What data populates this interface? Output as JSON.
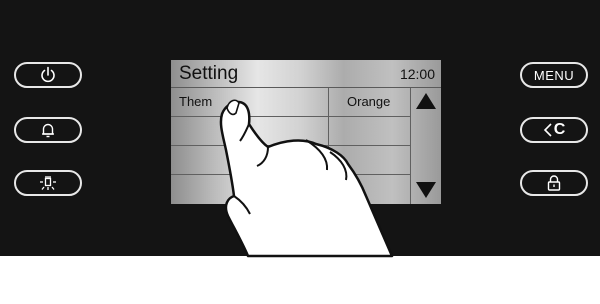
{
  "screen": {
    "title": "Setting",
    "time": "12:00",
    "rows": [
      {
        "label": "Them",
        "value": "Orange"
      },
      {
        "label": "",
        "value": ""
      },
      {
        "label": "",
        "value": ""
      },
      {
        "label": "",
        "value": ""
      }
    ],
    "scroll_up_icon": "triangle-up-icon",
    "scroll_down_icon": "triangle-down-icon"
  },
  "left_buttons": [
    {
      "name": "power-button",
      "icon": "power-icon"
    },
    {
      "name": "alarm-button",
      "icon": "bell-icon"
    },
    {
      "name": "light-button",
      "icon": "light-icon"
    }
  ],
  "right_buttons": {
    "menu_label": "MENU",
    "back_label": "C",
    "lock_icon": "lock-icon"
  },
  "overlay": {
    "icon": "touch-hand-icon"
  },
  "colors": {
    "panel": "#141414",
    "button_outline": "#e8e8e8"
  }
}
